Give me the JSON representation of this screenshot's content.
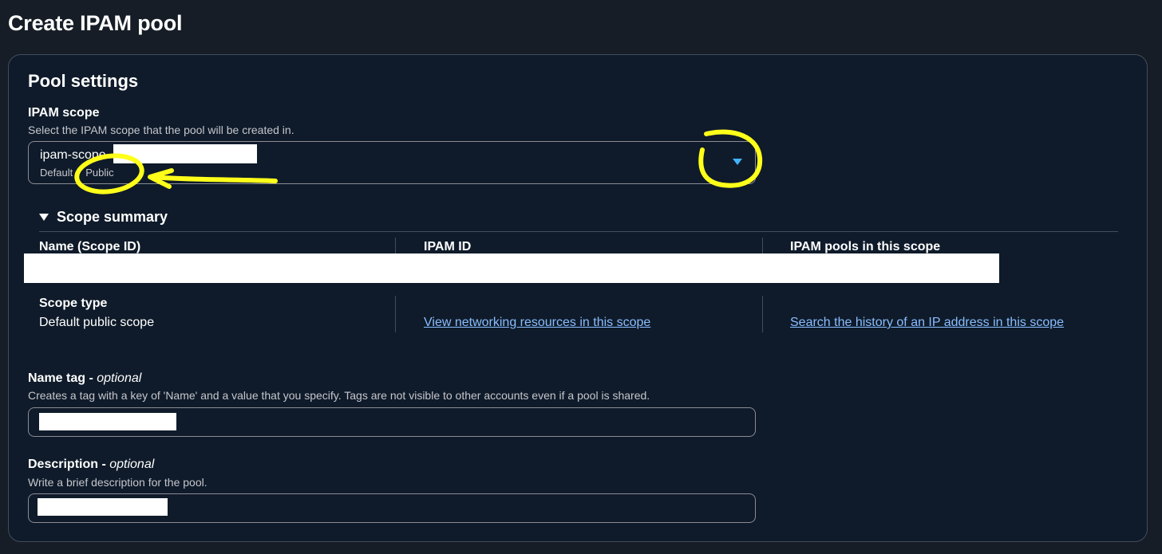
{
  "page": {
    "title": "Create IPAM pool"
  },
  "pool_settings": {
    "title": "Pool settings",
    "ipam_scope": {
      "label": "IPAM scope",
      "description": "Select the IPAM scope that the pool will be created in.",
      "selected_name": "ipam-scope",
      "selected_sub": "Default",
      "selected_tag": "Public"
    },
    "scope_summary": {
      "label": "Scope summary",
      "col1_header": "Name (Scope ID)",
      "col2_header": "IPAM ID",
      "col3_header": "IPAM pools in this scope",
      "scope_type_label": "Scope type",
      "scope_type_value": "Default public scope",
      "link_resources": "View networking resources in this scope",
      "link_history": "Search the history of an IP address in this scope"
    },
    "name_tag": {
      "label": "Name tag - ",
      "optional": "optional",
      "description": "Creates a tag with a key of 'Name' and a value that you specify. Tags are not visible to other accounts even if a pool is shared."
    },
    "description_field": {
      "label": "Description - ",
      "optional": "optional",
      "description": "Write a brief description for the pool."
    }
  },
  "colors": {
    "background": "#161d26",
    "panel": "#0f1b2a",
    "border": "#414d5c",
    "link": "#89bdff",
    "dropdown_caret": "#42b4ff",
    "annotation": "#ffff1a"
  }
}
